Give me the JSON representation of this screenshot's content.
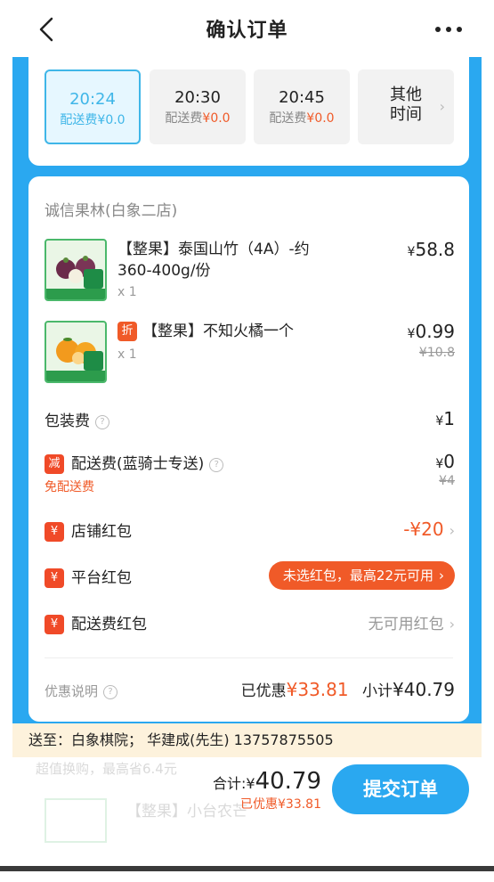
{
  "header": {
    "title": "确认订单"
  },
  "time_slots": [
    {
      "time": "20:24",
      "fee_label": "配送费",
      "fee": "¥0.0",
      "selected": true
    },
    {
      "time": "20:30",
      "fee_label": "配送费",
      "fee": "¥0.0",
      "selected": false
    },
    {
      "time": "20:45",
      "fee_label": "配送费",
      "fee": "¥0.0",
      "selected": false
    }
  ],
  "other_time": {
    "label_line1": "其他",
    "label_line2": "时间"
  },
  "store": {
    "name": "诚信果林(白象二店)"
  },
  "products": [
    {
      "name_line1": "【整果】泰国山竹（4A）-约",
      "name_line2": "360-400g/份",
      "qty": "x 1",
      "price_symbol": "¥",
      "price": "58.8"
    },
    {
      "badge": "折",
      "name": "【整果】不知火橘一个",
      "qty": "x 1",
      "price_symbol": "¥",
      "price": "0.99",
      "original_price": "¥10.8"
    }
  ],
  "fees": {
    "packing_label": "包装费",
    "packing_symbol": "¥",
    "packing_value": "1",
    "delivery_badge": "减",
    "delivery_label": "配送费(蓝骑士专送)",
    "delivery_symbol": "¥",
    "delivery_value": "0",
    "delivery_original": "¥4",
    "delivery_note": "免配送费"
  },
  "redpackets": {
    "badge": "¥",
    "store_label": "店铺红包",
    "store_value": "-¥20",
    "platform_label": "平台红包",
    "platform_value": "未选红包，最高22元可用",
    "delivery_label": "配送费红包",
    "delivery_value": "无可用红包"
  },
  "summary": {
    "discount_info_label": "优惠说明",
    "saved_label": "已优惠",
    "saved_value": "¥33.81",
    "subtotal_label": "小计",
    "subtotal_value": "¥40.79"
  },
  "address": {
    "text": "送至：白象棋院；  华建成(先生) 13757875505"
  },
  "ghost": {
    "line1": "超值换购，最高省6.4元",
    "line2": "【整果】小台农芒"
  },
  "bottom": {
    "total_label": "合计:",
    "total_symbol": "¥",
    "total_value": "40.79",
    "saved_text": "已优惠¥33.81",
    "submit_label": "提交订单"
  },
  "colors": {
    "accent": "#2aa8f0",
    "price_red": "#f05a28",
    "selected_slot": "#3fb6e8"
  }
}
